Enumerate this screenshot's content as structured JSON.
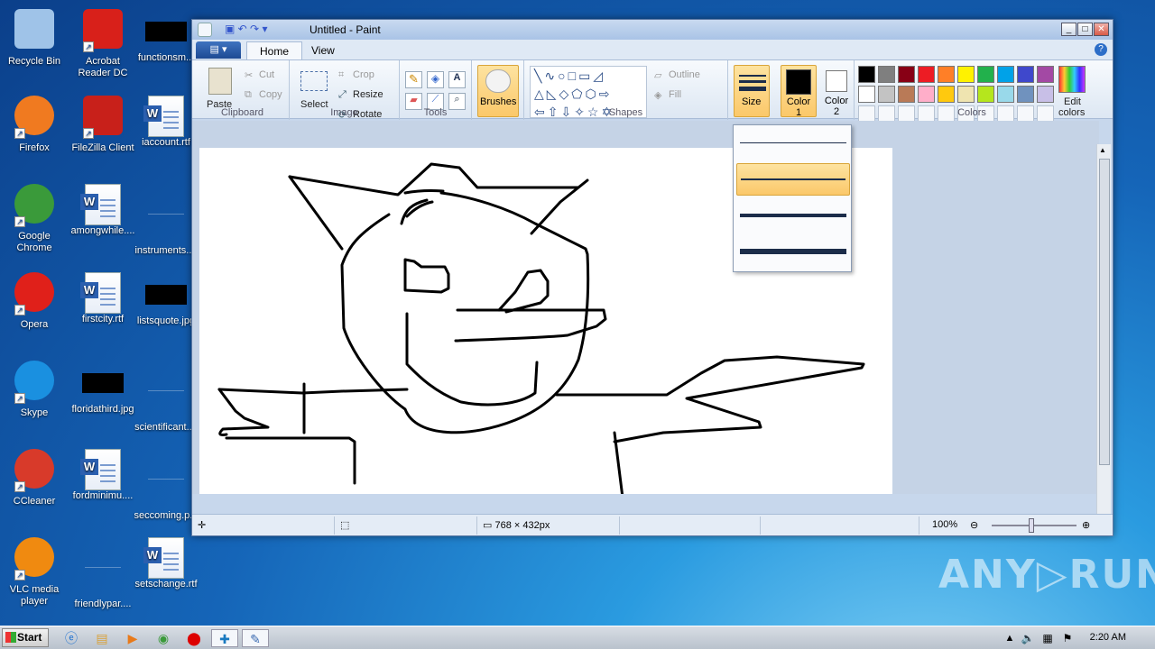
{
  "desktop_icons": [
    {
      "label": "Recycle Bin",
      "icon": "recycle-bin-icon"
    },
    {
      "label": "Acrobat Reader DC",
      "icon": "acrobat-icon"
    },
    {
      "label": "functionsm...",
      "icon": "blackbox-icon"
    },
    {
      "label": "Firefox",
      "icon": "firefox-icon"
    },
    {
      "label": "FileZilla Client",
      "icon": "filezilla-icon"
    },
    {
      "label": "iaccount.rtf",
      "icon": "word-doc-icon"
    },
    {
      "label": "Google Chrome",
      "icon": "chrome-icon"
    },
    {
      "label": "amongwhile....",
      "icon": "word-doc-icon"
    },
    {
      "label": "instruments....",
      "icon": "blank-icon"
    },
    {
      "label": "Opera",
      "icon": "opera-icon"
    },
    {
      "label": "firstcity.rtf",
      "icon": "word-doc-icon"
    },
    {
      "label": "listsquote.jpg",
      "icon": "blackbox-icon"
    },
    {
      "label": "Skype",
      "icon": "skype-icon"
    },
    {
      "label": "floridathird.jpg",
      "icon": "blackbox-icon"
    },
    {
      "label": "scientificant....",
      "icon": "blank-icon"
    },
    {
      "label": "CCleaner",
      "icon": "ccleaner-icon"
    },
    {
      "label": "fordminimu....",
      "icon": "word-doc-icon"
    },
    {
      "label": "seccoming.p...",
      "icon": "blank-icon"
    },
    {
      "label": "VLC media player",
      "icon": "vlc-icon"
    },
    {
      "label": "friendlypar....",
      "icon": "blank-icon"
    },
    {
      "label": "setschange.rtf",
      "icon": "word-doc-icon"
    }
  ],
  "window": {
    "title": "Untitled - Paint",
    "min": "_",
    "max": "□",
    "close": "✕",
    "help": "?"
  },
  "tabs": {
    "file": "▤ ▾",
    "home": "Home",
    "view": "View"
  },
  "clipboard": {
    "paste": "Paste",
    "cut": "Cut",
    "copy": "Copy",
    "label": "Clipboard"
  },
  "image": {
    "select": "Select",
    "crop": "Crop",
    "resize": "Resize",
    "rotate": "Rotate",
    "label": "Image"
  },
  "tools": {
    "label": "Tools"
  },
  "brushes": {
    "label": "Brushes"
  },
  "shapes": {
    "label": "Shapes",
    "outline": "Outline",
    "fill": "Fill"
  },
  "size": {
    "label": "Size"
  },
  "color1": {
    "label1": "Color",
    "label2": "1",
    "value": "#000000"
  },
  "color2": {
    "label1": "Color",
    "label2": "2",
    "value": "#ffffff"
  },
  "colors": {
    "label": "Colors",
    "edit1": "Edit",
    "edit2": "colors",
    "row1": [
      "#000000",
      "#7f7f7f",
      "#880015",
      "#ed1c24",
      "#ff7f27",
      "#fff200",
      "#22b14c",
      "#00a2e8",
      "#3f48cc",
      "#a349a4"
    ],
    "row2": [
      "#ffffff",
      "#c3c3c3",
      "#b97a57",
      "#ffaec9",
      "#ffc90e",
      "#efe4b0",
      "#b5e61d",
      "#99d9ea",
      "#7092be",
      "#c8bfe7"
    ]
  },
  "status": {
    "dimensions": "768 × 432px",
    "zoom": "100%"
  },
  "taskbar": {
    "start": "Start",
    "clock": "2:20 AM"
  },
  "watermark": "ANY▷RUN"
}
